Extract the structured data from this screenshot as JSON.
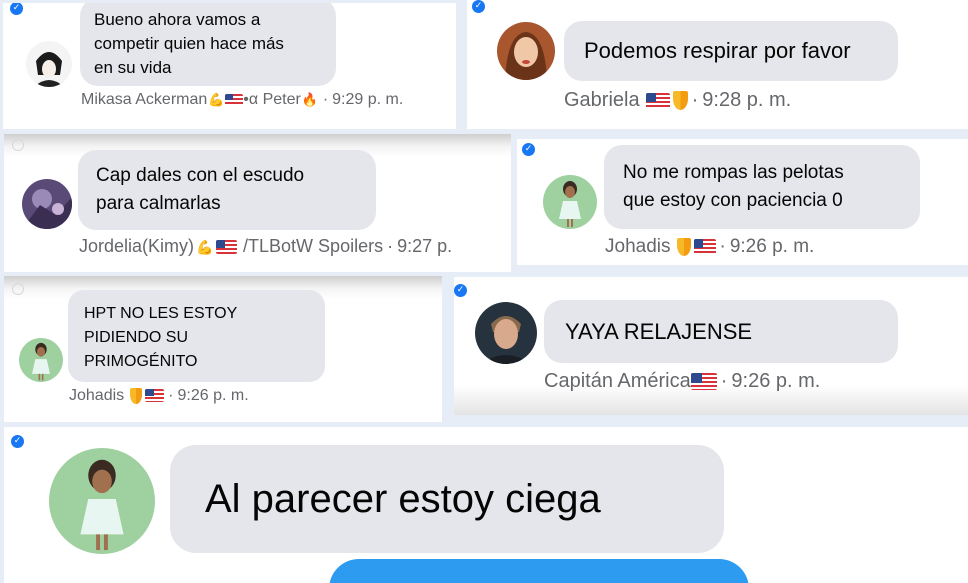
{
  "colors": {
    "background": "#e7edf7",
    "bubble": "#e4e6eb",
    "meta_text": "#65676b",
    "check": "#1877f2",
    "strip": "#2d9cf0"
  },
  "messages": [
    {
      "text": "Bueno ahora vamos a\ncompetir quien hace más\nen su vida",
      "author": "Mikasa Ackerman",
      "author_suffix": "•α Peter",
      "badges": [
        "flexed-biceps-emoji",
        "us-flag-icon",
        "fire-emoji"
      ],
      "time": "9:29 p. m.",
      "selected": true
    },
    {
      "text": "Podemos respirar por favor",
      "author": "Gabriela",
      "badges": [
        "us-flag-icon",
        "shield-icon"
      ],
      "time": "9:28 p. m.",
      "selected": true
    },
    {
      "text": "Cap dales con el escudo\npara calmarlas",
      "author": "Jordelia(Kimy)",
      "author_suffix": "/TLBotW Spoilers",
      "badges": [
        "flexed-biceps-emoji",
        "us-flag-icon"
      ],
      "time": "9:27 p.",
      "selected": false
    },
    {
      "text": "No me rompas las pelotas\nque estoy con paciencia 0",
      "author": "Johadis",
      "badges": [
        "shield-icon",
        "us-flag-icon"
      ],
      "time": "9:26 p. m.",
      "selected": true
    },
    {
      "text": "HPT NO LES ESTOY\nPIDIENDO SU\nPRIMOGÉNITO",
      "author": "Johadis",
      "badges": [
        "shield-icon",
        "us-flag-icon"
      ],
      "time": "9:26 p. m.",
      "selected": false
    },
    {
      "text": "YAYA RELAJENSE",
      "author": "Capitán América",
      "badges": [
        "us-flag-icon"
      ],
      "time": "9:26 p. m.",
      "selected": true
    },
    {
      "text": "Al parecer estoy ciega",
      "selected": true
    }
  ]
}
